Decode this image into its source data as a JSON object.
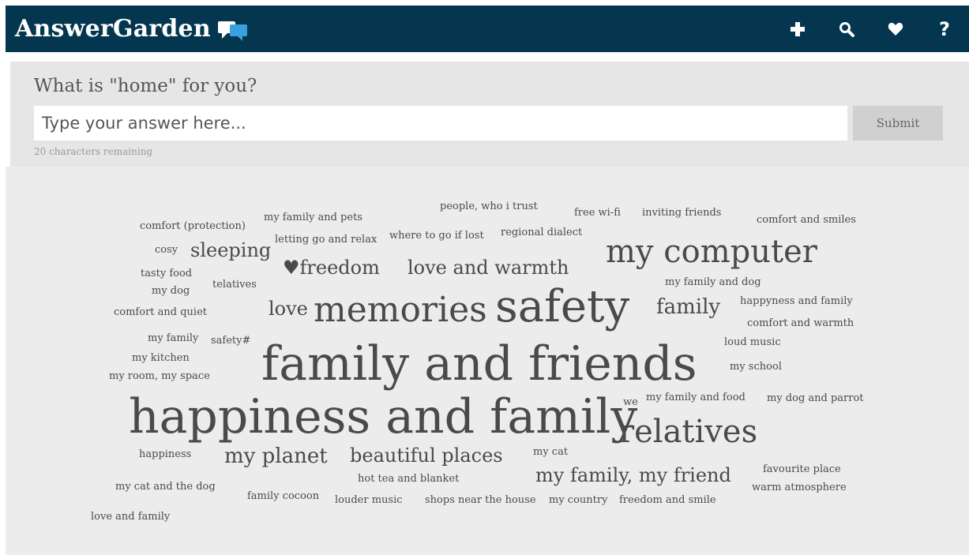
{
  "app": {
    "logo_text": "AnswerGarden",
    "nav_icons": [
      "plus-icon",
      "search-icon",
      "heart-icon",
      "help-icon"
    ],
    "nav_glyphs": {
      "plus": "+",
      "search": "⌕",
      "heart": "♥",
      "help": "?"
    }
  },
  "question": {
    "title": "What is \"home\" for you?",
    "input_placeholder": "Type your answer here...",
    "submit_label": "Submit",
    "chars_remaining": "20 characters remaining"
  },
  "cloud": {
    "words": [
      "comfort (protection)",
      "my family and pets",
      "people, who i trust",
      "free wi-fi",
      "inviting friends",
      "comfort and smiles",
      "letting go and relax",
      "where to go if lost",
      "regional dialect",
      "cosy",
      "sleeping",
      "my computer",
      "freedom",
      "love and warmth",
      "tasty food",
      "telatives",
      "my dog",
      "my family and dog",
      "love",
      "memories",
      "safety",
      "family",
      "happyness and family",
      "comfort and quiet",
      "comfort and warmth",
      "my family",
      "safety#",
      "loud music",
      "my kitchen",
      "family and friends",
      "my school",
      "my room, my space",
      "we",
      "my family and food",
      "my dog and parrot",
      "happiness and family",
      "relatives",
      "happiness",
      "my planet",
      "beautiful places",
      "my cat",
      "favourite place",
      "my family, my friend",
      "hot tea and blanket",
      "my cat and the dog",
      "warm atmosphere",
      "family cocoon",
      "louder music",
      "shops near the house",
      "my country",
      "freedom and smile",
      "love and family"
    ]
  },
  "colors": {
    "header_bg": "#05364f",
    "panel_bg": "#e6e6e6",
    "cloud_bg": "#ececec",
    "word_color": "#4a4a4a",
    "submit_bg": "#d0d0d0"
  }
}
